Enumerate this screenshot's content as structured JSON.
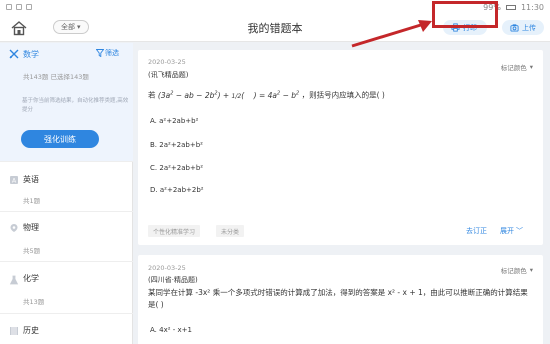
{
  "status_bar": {
    "battery": "99%",
    "time": "11:30"
  },
  "header": {
    "filter_label": "全部",
    "title": "我的错题本",
    "print_label": "打印",
    "upload_label": "上传"
  },
  "sidebar": {
    "current": {
      "name": "数学",
      "screen_label": "筛选",
      "stats": "共143题   已选择143题",
      "hint": "基于你当前筛选结果，自动化推荐类题,高效提分",
      "train_label": "强化训练"
    },
    "subjects": [
      {
        "name": "英语",
        "count": "共1题"
      },
      {
        "name": "物理",
        "count": "共5题"
      },
      {
        "name": "化学",
        "count": "共13题"
      },
      {
        "name": "历史",
        "count": ""
      }
    ]
  },
  "cards": [
    {
      "date": "2020-03-25",
      "source": "(讯飞精品题)",
      "mark_label": "标记颜色",
      "question_prefix": "若",
      "question_suffix": "，则括号内应填入的是(  )",
      "options": [
        {
          "label": "A.",
          "text": "a²+2ab+b²"
        },
        {
          "label": "B.",
          "text": "2a²+2ab+b²"
        },
        {
          "label": "C.",
          "text": "2a²+2ab+b²"
        },
        {
          "label": "D.",
          "text": "a²+2ab+2b²"
        }
      ],
      "tags": [
        "个性化精准学习",
        "未分类"
      ],
      "revise_label": "去订正",
      "expand_label": "展开"
    },
    {
      "date": "2020-03-25",
      "source": "(四川省·精品题)",
      "mark_label": "标记颜色",
      "question": "某同学在计算 -3x² 乘一个多项式时错误的计算成了加法，得到的答案是 x² - x + 1，由此可以推断正确的计算结果是(  )",
      "options": [
        {
          "label": "A.",
          "text": "4x² - x+1"
        }
      ]
    }
  ]
}
